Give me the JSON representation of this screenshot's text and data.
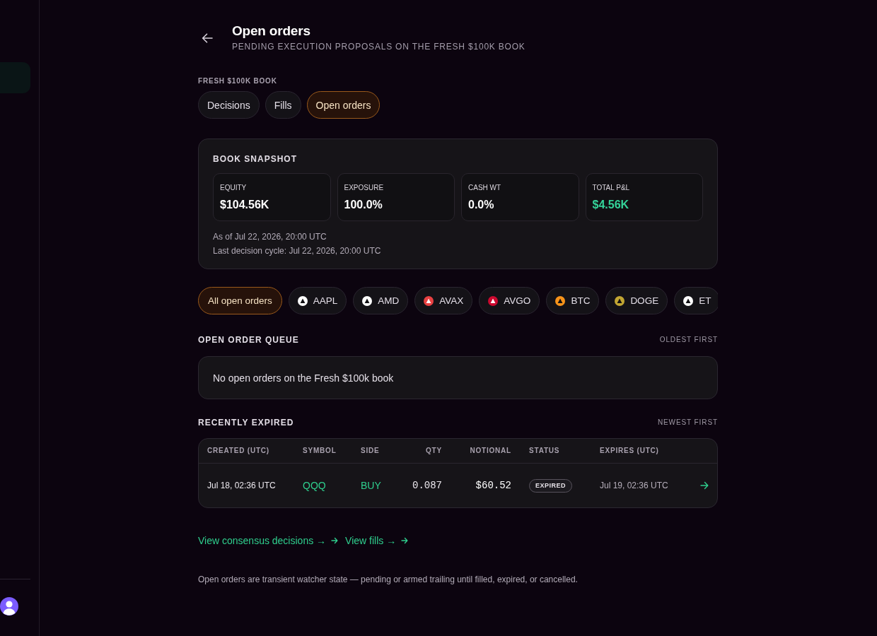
{
  "sidebar": {
    "nav_items": [
      {
        "selected": true
      }
    ]
  },
  "header": {
    "title": "Open orders",
    "subtitle": "PENDING EXECUTION PROPOSALS ON THE FRESH $100K BOOK"
  },
  "book_tabs": {
    "label": "FRESH $100K BOOK",
    "tabs": [
      {
        "label": "Decisions",
        "selected": false
      },
      {
        "label": "Fills",
        "selected": false
      },
      {
        "label": "Open orders",
        "selected": true
      }
    ]
  },
  "snapshot": {
    "title": "BOOK SNAPSHOT",
    "metrics": [
      {
        "label": "EQUITY",
        "value": "$104.56K",
        "color": "#ffffff"
      },
      {
        "label": "EXPOSURE",
        "value": "100.0%",
        "color": "#ffffff"
      },
      {
        "label": "CASH WT",
        "value": "0.0%",
        "color": "#ffffff"
      },
      {
        "label": "TOTAL P&L",
        "value": "$4.56K",
        "color": "#34d399"
      }
    ],
    "as_of": "As of Jul 22, 2026, 20:00 UTC",
    "last_cycle": "Last decision cycle: Jul 22, 2026, 20:00 UTC"
  },
  "filters": [
    {
      "label": "All open orders",
      "selected": true
    },
    {
      "label": "AAPL",
      "selected": false,
      "color": "#ffffff"
    },
    {
      "label": "AMD",
      "selected": false,
      "color": "#ffffff"
    },
    {
      "label": "AVAX",
      "selected": false,
      "color": "#e84142"
    },
    {
      "label": "AVGO",
      "selected": false,
      "color": "#cc092f"
    },
    {
      "label": "BTC",
      "selected": false,
      "color": "#f7931a"
    },
    {
      "label": "DOGE",
      "selected": false,
      "color": "#c2a633"
    },
    {
      "label": "ET",
      "selected": false,
      "color": "#ffffff"
    }
  ],
  "queue": {
    "title": "OPEN ORDER QUEUE",
    "sort": "OLDEST FIRST",
    "empty_message": "No open orders on the Fresh $100k book"
  },
  "expired": {
    "title": "RECENTLY EXPIRED",
    "sort": "NEWEST FIRST",
    "table": {
      "columns": [
        "CREATED (UTC)",
        "SYMBOL",
        "SIDE",
        "QTY",
        "NOTIONAL",
        "STATUS",
        "EXPIRES (UTC)"
      ],
      "rows": [
        {
          "created": "Jul 18, 02:36 UTC",
          "symbol": "QQQ",
          "side": "BUY",
          "qty": "0.087",
          "notional": "$60.52",
          "status": "EXPIRED",
          "expires": "Jul 19, 02:36 UTC"
        }
      ]
    }
  },
  "links": [
    {
      "label": "View consensus decisions →"
    },
    {
      "label": "View fills →"
    }
  ],
  "footnote": "Open orders are transient watcher state — pending or armed trailing until filled, expired, or cancelled."
}
